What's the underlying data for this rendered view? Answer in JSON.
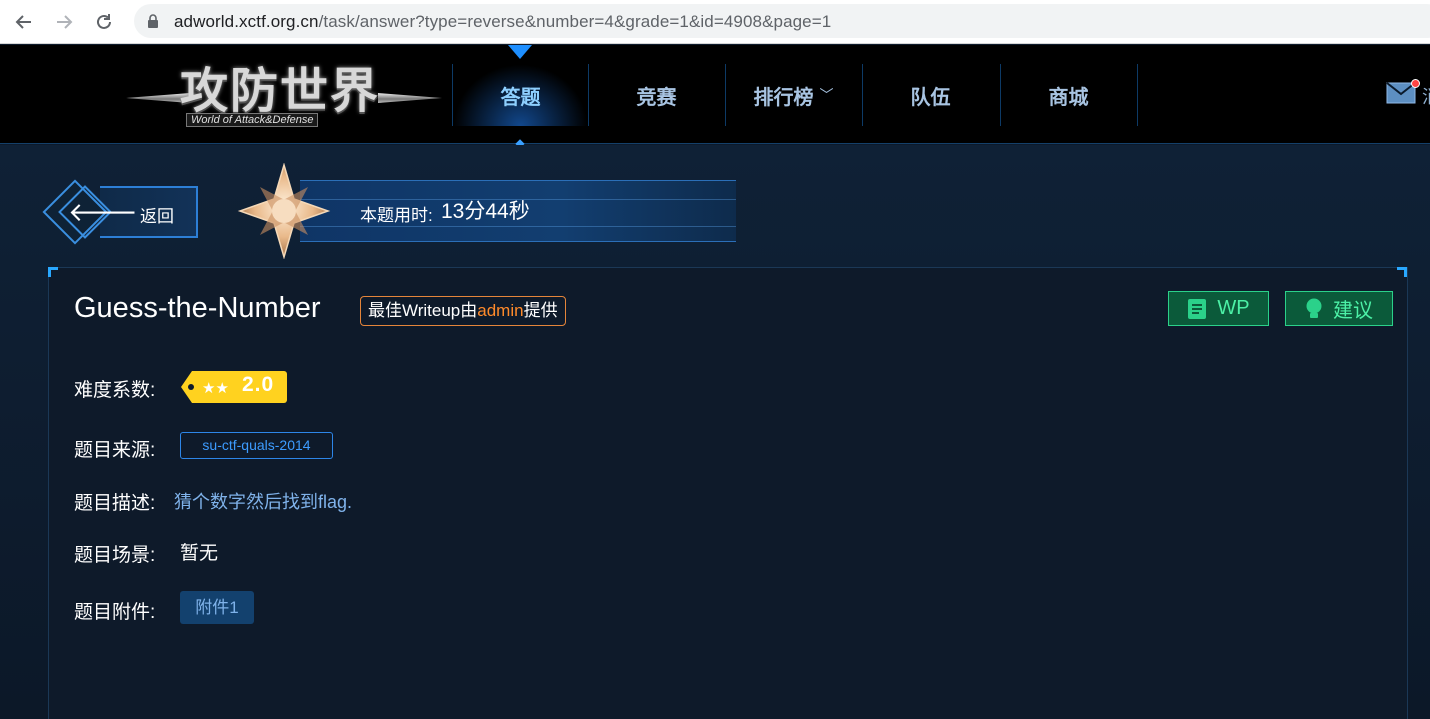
{
  "browser": {
    "url_host": "adworld.xctf.org.cn",
    "url_path": "/task/answer?type=reverse&number=4&grade=1&id=4908&page=1"
  },
  "header": {
    "logo_text": "攻防世界",
    "logo_subtitle": "World of Attack&Defense",
    "nav": [
      {
        "label": "答题",
        "active": true
      },
      {
        "label": "竞赛",
        "active": false
      },
      {
        "label": "排行榜",
        "active": false,
        "has_dropdown": true
      },
      {
        "label": "队伍",
        "active": false
      },
      {
        "label": "商城",
        "active": false
      }
    ],
    "mail_text": "消"
  },
  "back": {
    "label": "返回"
  },
  "timer": {
    "label": "本题用时:",
    "value": "13分44秒"
  },
  "task": {
    "title": "Guess-the-Number",
    "writeup": {
      "prefix": "最佳Writeup由",
      "author": "admin",
      "suffix": "提供"
    },
    "wp_label": "WP",
    "advice_label": "建议",
    "difficulty_label": "难度系数:",
    "difficulty_value": "2.0",
    "difficulty_stars": 2,
    "source_label": "题目来源:",
    "source_value": "su-ctf-quals-2014",
    "desc_label": "题目描述:",
    "desc_value": "猜个数字然后找到flag.",
    "scene_label": "题目场景:",
    "scene_value": "暂无",
    "attach_label": "题目附件:",
    "attach_value": "附件1"
  },
  "colors": {
    "accent_blue": "#1e8fff",
    "green": "#4cf0a6",
    "orange": "#ff8a2a",
    "tag_yellow": "#ffd21f"
  }
}
